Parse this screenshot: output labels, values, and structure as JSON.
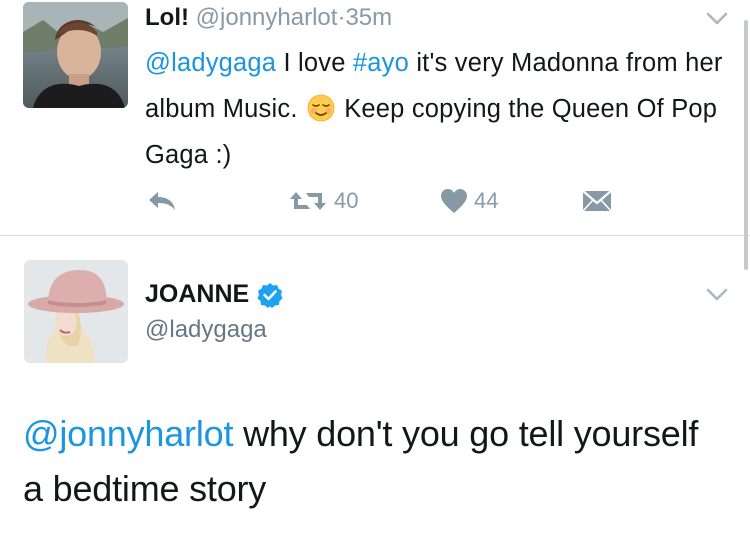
{
  "colors": {
    "link": "#1b95e0",
    "muted": "#8899a6",
    "verified": "#1da1f2",
    "divider": "#d8dde2"
  },
  "tweet1": {
    "name": "Lol!",
    "handle": "@jonnyharlot",
    "separator": "·",
    "time": "35m",
    "body": {
      "mention": "@ladygaga",
      "text1": " I love ",
      "hashtag": "#ayo",
      "text2": " it's very Madonna from her album Music. ",
      "emoji": "relieved-smile-emoji",
      "text3": " Keep copying the Queen Of Pop Gaga :)"
    },
    "actions": {
      "reply_icon": "reply-icon",
      "retweet_icon": "retweet-icon",
      "retweet_count": "40",
      "like_icon": "heart-icon",
      "like_count": "44",
      "dm_icon": "envelope-icon"
    },
    "menu_icon": "chevron-down-icon"
  },
  "tweet2": {
    "name": "JOANNE",
    "verified_icon": "verified-badge-icon",
    "handle": "@ladygaga",
    "body": {
      "mention": "@jonnyharlot",
      "text": " why don't you go tell yourself a bedtime story"
    },
    "menu_icon": "chevron-down-icon"
  }
}
